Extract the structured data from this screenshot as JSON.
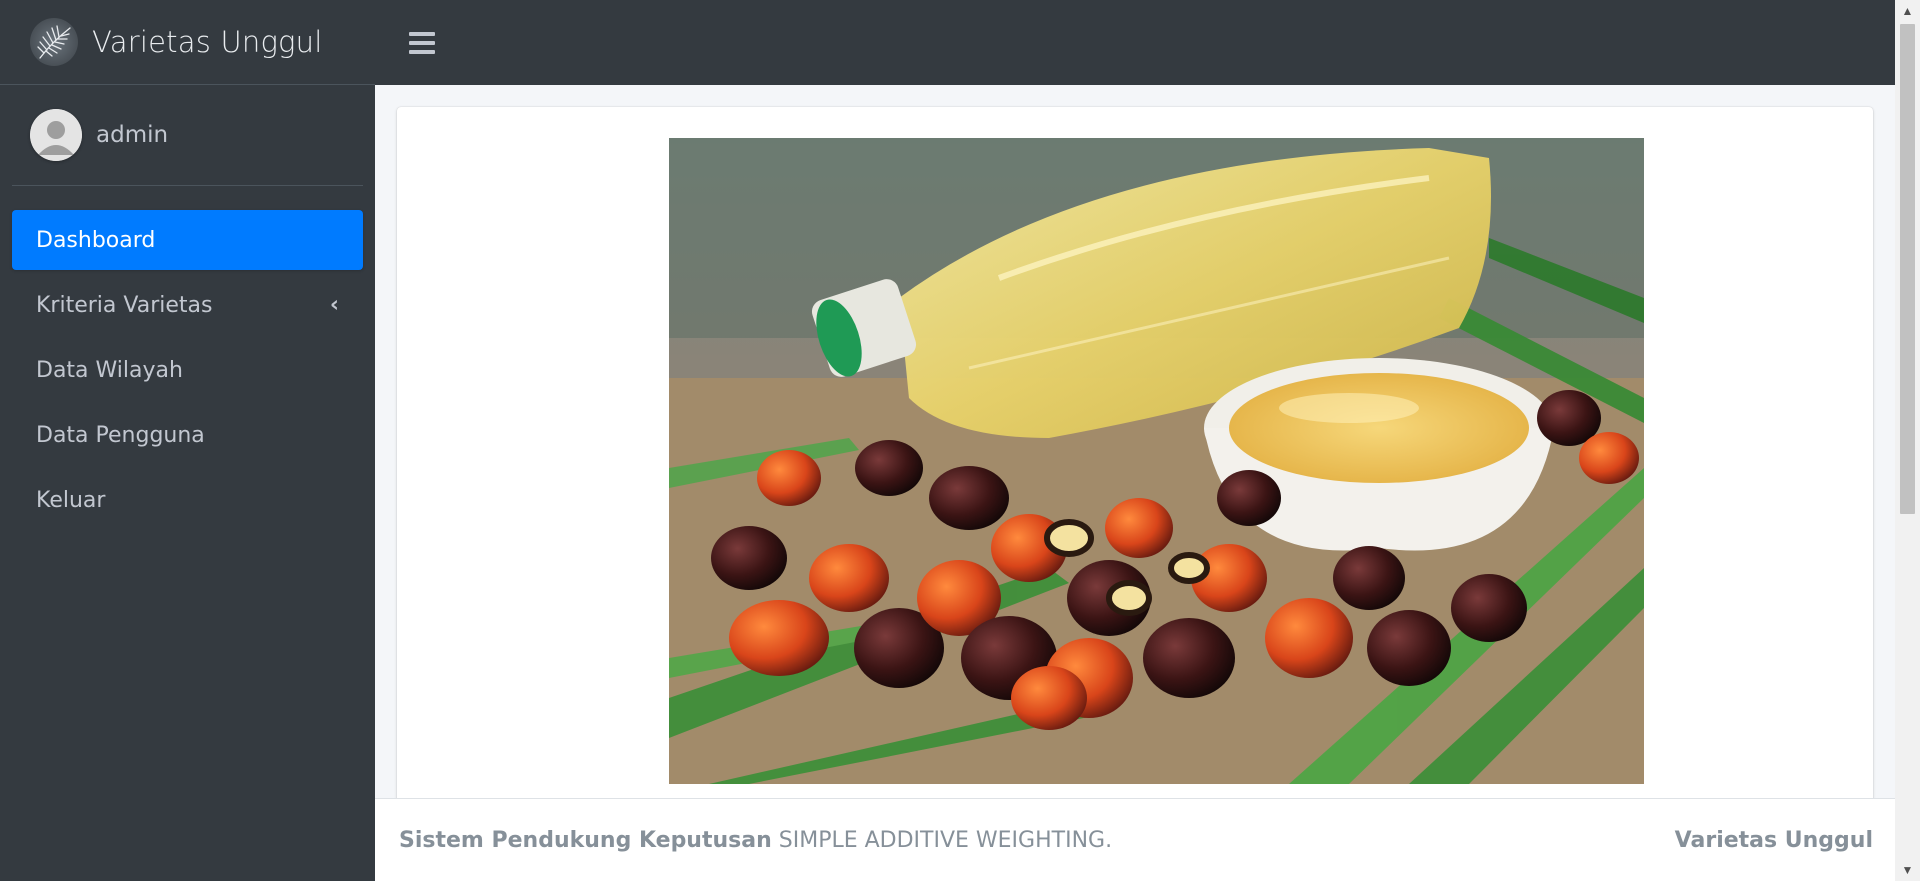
{
  "brand": {
    "title": "Varietas Unggul",
    "logo_icon": "palm-leaf-icon"
  },
  "user": {
    "name": "admin",
    "avatar_icon": "user-avatar-icon"
  },
  "sidebar": {
    "items": [
      {
        "label": "Dashboard",
        "active": true
      },
      {
        "label": "Kriteria Varietas",
        "has_submenu": true,
        "caret": "‹"
      },
      {
        "label": "Data Wilayah"
      },
      {
        "label": "Data Pengguna"
      },
      {
        "label": "Keluar"
      }
    ]
  },
  "topbar": {
    "menu_icon": "hamburger-menu-icon"
  },
  "main": {
    "hero_image": "palm-oil-bottle-bowl-and-palm-fruits-photo"
  },
  "footer": {
    "left_bold": "Sistem Pendukung Keputusan",
    "left_text": "SIMPLE ADDITIVE WEIGHTING.",
    "right_bold": "Varietas Unggul"
  },
  "colors": {
    "sidebar_bg": "#343a40",
    "active_item": "#007bff",
    "content_bg": "#f4f6f9",
    "footer_text": "#869099"
  }
}
